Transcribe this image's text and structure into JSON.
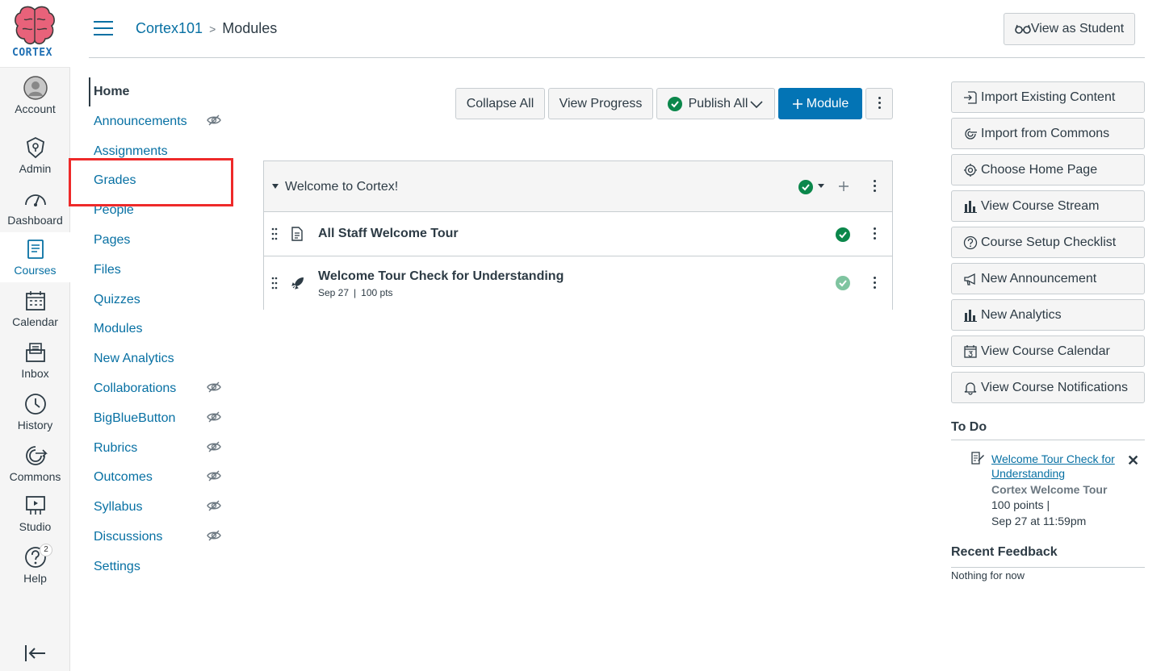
{
  "global_nav": {
    "logo_text": "CORTEX",
    "items": [
      {
        "label": "Account",
        "icon": "avatar-icon"
      },
      {
        "label": "Admin",
        "icon": "shield-icon"
      },
      {
        "label": "Dashboard",
        "icon": "gauge-icon"
      },
      {
        "label": "Courses",
        "icon": "book-icon",
        "active": true
      },
      {
        "label": "Calendar",
        "icon": "calendar-icon"
      },
      {
        "label": "Inbox",
        "icon": "inbox-icon"
      },
      {
        "label": "History",
        "icon": "clock-icon"
      },
      {
        "label": "Commons",
        "icon": "commons-icon"
      },
      {
        "label": "Studio",
        "icon": "studio-icon"
      },
      {
        "label": "Help",
        "icon": "help-icon",
        "badge": "2"
      }
    ]
  },
  "header": {
    "breadcrumb_course": "Cortex101",
    "breadcrumb_page": "Modules",
    "view_as_student": "View as Student"
  },
  "course_nav": [
    {
      "label": "Home",
      "hidden": false,
      "active": true
    },
    {
      "label": "Announcements",
      "hidden": true
    },
    {
      "label": "Assignments",
      "hidden": false
    },
    {
      "label": "Grades",
      "hidden": false
    },
    {
      "label": "People",
      "hidden": false
    },
    {
      "label": "Pages",
      "hidden": false
    },
    {
      "label": "Files",
      "hidden": false
    },
    {
      "label": "Quizzes",
      "hidden": false
    },
    {
      "label": "Modules",
      "hidden": false
    },
    {
      "label": "New Analytics",
      "hidden": false
    },
    {
      "label": "Collaborations",
      "hidden": true
    },
    {
      "label": "BigBlueButton",
      "hidden": true
    },
    {
      "label": "Rubrics",
      "hidden": true
    },
    {
      "label": "Outcomes",
      "hidden": true
    },
    {
      "label": "Syllabus",
      "hidden": true
    },
    {
      "label": "Discussions",
      "hidden": true
    },
    {
      "label": "Settings",
      "hidden": false
    }
  ],
  "toolbar": {
    "collapse_all": "Collapse All",
    "view_progress": "View Progress",
    "publish_all": "Publish All",
    "add_module": "Module"
  },
  "module": {
    "title": "Welcome to Cortex!",
    "items": [
      {
        "title": "All Staff Welcome Tour",
        "meta_date": "",
        "meta_pts": "",
        "type": "page"
      },
      {
        "title": "Welcome Tour Check for Understanding",
        "meta_date": "Sep 27",
        "meta_pts": "100 pts",
        "type": "quiz"
      }
    ]
  },
  "sidebar": {
    "buttons": [
      {
        "label": "Import Existing Content",
        "icon": "import-icon"
      },
      {
        "label": "Import from Commons",
        "icon": "commons-icon"
      },
      {
        "label": "Choose Home Page",
        "icon": "target-icon"
      },
      {
        "label": "View Course Stream",
        "icon": "bar-chart-icon"
      },
      {
        "label": "Course Setup Checklist",
        "icon": "question-icon"
      },
      {
        "label": "New Announcement",
        "icon": "megaphone-icon"
      },
      {
        "label": "New Analytics",
        "icon": "bar-chart-icon"
      },
      {
        "label": "View Course Calendar",
        "icon": "calendar-icon"
      },
      {
        "label": "View Course Notifications",
        "icon": "bell-icon"
      }
    ],
    "todo_title": "To Do",
    "todo": {
      "link": "Welcome Tour Check for Understanding",
      "course": "Cortex Welcome Tour",
      "points": "100 points  |",
      "due": "Sep 27 at 11:59pm"
    },
    "recent_feedback_title": "Recent Feedback",
    "recent_feedback_text": "Nothing for now"
  }
}
